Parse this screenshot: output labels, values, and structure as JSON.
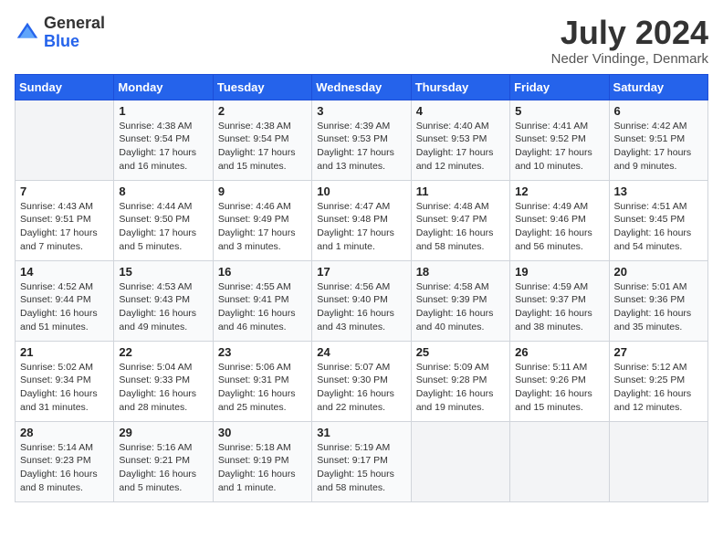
{
  "header": {
    "logo_general": "General",
    "logo_blue": "Blue",
    "month_year": "July 2024",
    "location": "Neder Vindinge, Denmark"
  },
  "days_of_week": [
    "Sunday",
    "Monday",
    "Tuesday",
    "Wednesday",
    "Thursday",
    "Friday",
    "Saturday"
  ],
  "weeks": [
    [
      {
        "day": "",
        "info": ""
      },
      {
        "day": "1",
        "info": "Sunrise: 4:38 AM\nSunset: 9:54 PM\nDaylight: 17 hours and 16 minutes."
      },
      {
        "day": "2",
        "info": "Sunrise: 4:38 AM\nSunset: 9:54 PM\nDaylight: 17 hours and 15 minutes."
      },
      {
        "day": "3",
        "info": "Sunrise: 4:39 AM\nSunset: 9:53 PM\nDaylight: 17 hours and 13 minutes."
      },
      {
        "day": "4",
        "info": "Sunrise: 4:40 AM\nSunset: 9:53 PM\nDaylight: 17 hours and 12 minutes."
      },
      {
        "day": "5",
        "info": "Sunrise: 4:41 AM\nSunset: 9:52 PM\nDaylight: 17 hours and 10 minutes."
      },
      {
        "day": "6",
        "info": "Sunrise: 4:42 AM\nSunset: 9:51 PM\nDaylight: 17 hours and 9 minutes."
      }
    ],
    [
      {
        "day": "7",
        "info": "Sunrise: 4:43 AM\nSunset: 9:51 PM\nDaylight: 17 hours and 7 minutes."
      },
      {
        "day": "8",
        "info": "Sunrise: 4:44 AM\nSunset: 9:50 PM\nDaylight: 17 hours and 5 minutes."
      },
      {
        "day": "9",
        "info": "Sunrise: 4:46 AM\nSunset: 9:49 PM\nDaylight: 17 hours and 3 minutes."
      },
      {
        "day": "10",
        "info": "Sunrise: 4:47 AM\nSunset: 9:48 PM\nDaylight: 17 hours and 1 minute."
      },
      {
        "day": "11",
        "info": "Sunrise: 4:48 AM\nSunset: 9:47 PM\nDaylight: 16 hours and 58 minutes."
      },
      {
        "day": "12",
        "info": "Sunrise: 4:49 AM\nSunset: 9:46 PM\nDaylight: 16 hours and 56 minutes."
      },
      {
        "day": "13",
        "info": "Sunrise: 4:51 AM\nSunset: 9:45 PM\nDaylight: 16 hours and 54 minutes."
      }
    ],
    [
      {
        "day": "14",
        "info": "Sunrise: 4:52 AM\nSunset: 9:44 PM\nDaylight: 16 hours and 51 minutes."
      },
      {
        "day": "15",
        "info": "Sunrise: 4:53 AM\nSunset: 9:43 PM\nDaylight: 16 hours and 49 minutes."
      },
      {
        "day": "16",
        "info": "Sunrise: 4:55 AM\nSunset: 9:41 PM\nDaylight: 16 hours and 46 minutes."
      },
      {
        "day": "17",
        "info": "Sunrise: 4:56 AM\nSunset: 9:40 PM\nDaylight: 16 hours and 43 minutes."
      },
      {
        "day": "18",
        "info": "Sunrise: 4:58 AM\nSunset: 9:39 PM\nDaylight: 16 hours and 40 minutes."
      },
      {
        "day": "19",
        "info": "Sunrise: 4:59 AM\nSunset: 9:37 PM\nDaylight: 16 hours and 38 minutes."
      },
      {
        "day": "20",
        "info": "Sunrise: 5:01 AM\nSunset: 9:36 PM\nDaylight: 16 hours and 35 minutes."
      }
    ],
    [
      {
        "day": "21",
        "info": "Sunrise: 5:02 AM\nSunset: 9:34 PM\nDaylight: 16 hours and 31 minutes."
      },
      {
        "day": "22",
        "info": "Sunrise: 5:04 AM\nSunset: 9:33 PM\nDaylight: 16 hours and 28 minutes."
      },
      {
        "day": "23",
        "info": "Sunrise: 5:06 AM\nSunset: 9:31 PM\nDaylight: 16 hours and 25 minutes."
      },
      {
        "day": "24",
        "info": "Sunrise: 5:07 AM\nSunset: 9:30 PM\nDaylight: 16 hours and 22 minutes."
      },
      {
        "day": "25",
        "info": "Sunrise: 5:09 AM\nSunset: 9:28 PM\nDaylight: 16 hours and 19 minutes."
      },
      {
        "day": "26",
        "info": "Sunrise: 5:11 AM\nSunset: 9:26 PM\nDaylight: 16 hours and 15 minutes."
      },
      {
        "day": "27",
        "info": "Sunrise: 5:12 AM\nSunset: 9:25 PM\nDaylight: 16 hours and 12 minutes."
      }
    ],
    [
      {
        "day": "28",
        "info": "Sunrise: 5:14 AM\nSunset: 9:23 PM\nDaylight: 16 hours and 8 minutes."
      },
      {
        "day": "29",
        "info": "Sunrise: 5:16 AM\nSunset: 9:21 PM\nDaylight: 16 hours and 5 minutes."
      },
      {
        "day": "30",
        "info": "Sunrise: 5:18 AM\nSunset: 9:19 PM\nDaylight: 16 hours and 1 minute."
      },
      {
        "day": "31",
        "info": "Sunrise: 5:19 AM\nSunset: 9:17 PM\nDaylight: 15 hours and 58 minutes."
      },
      {
        "day": "",
        "info": ""
      },
      {
        "day": "",
        "info": ""
      },
      {
        "day": "",
        "info": ""
      }
    ]
  ]
}
